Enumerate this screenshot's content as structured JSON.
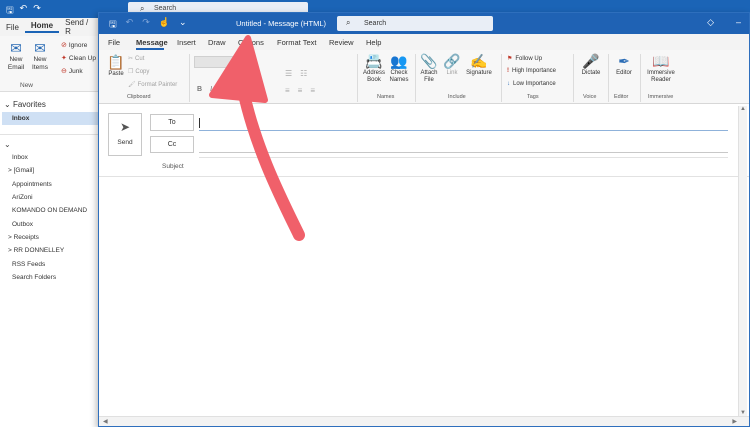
{
  "background_window": {
    "search_label": "Search",
    "tabs": [
      "File",
      "Home",
      "Send / R"
    ],
    "ribbon": {
      "new_email": "New Email",
      "new_items": "New Items",
      "ignore": "Ignore",
      "clean_up": "Clean Up",
      "junk": "Junk",
      "group_label": "New"
    },
    "nav": {
      "favorites": "Favorites",
      "favorites_inbox": "Inbox",
      "folders": [
        "Inbox",
        "> [Gmail]",
        "Appointments",
        "AriZoni",
        "KOMANDO ON DEMAND",
        "Outbox",
        "> Receipts",
        "> RR DONNELLEY",
        "RSS Feeds",
        "Search Folders"
      ]
    }
  },
  "compose_window": {
    "title": "Untitled - Message (HTML)",
    "search_label": "Search",
    "tabs": [
      "File",
      "Message",
      "Insert",
      "Draw",
      "Options",
      "Format Text",
      "Review",
      "Help"
    ],
    "active_tab": "Message",
    "ribbon": {
      "paste": "Paste",
      "cut": "Cut",
      "copy": "Copy",
      "format_painter": "Format Painter",
      "clipboard_group": "Clipboard",
      "address_book": "Address Book",
      "check_names": "Check Names",
      "names_group": "Names",
      "attach_file": "Attach File",
      "link": "Link",
      "signature": "Signature",
      "include_group": "Include",
      "follow_up": "Follow Up",
      "high_importance": "High Importance",
      "low_importance": "Low Importance",
      "tags_group": "Tags",
      "dictate": "Dictate",
      "voice_group": "Voice",
      "editor": "Editor",
      "editor_group": "Editor",
      "immersive_reader": "Immersive Reader",
      "immersive_group": "Immersive"
    },
    "compose": {
      "send_label": "Send",
      "to_label": "To",
      "cc_label": "Cc",
      "subject_label": "Subject",
      "to_value": "",
      "cc_value": "",
      "subject_value": ""
    }
  },
  "colors": {
    "title_bar": "#1f62b4",
    "annotation_arrow": "#f0606a"
  }
}
